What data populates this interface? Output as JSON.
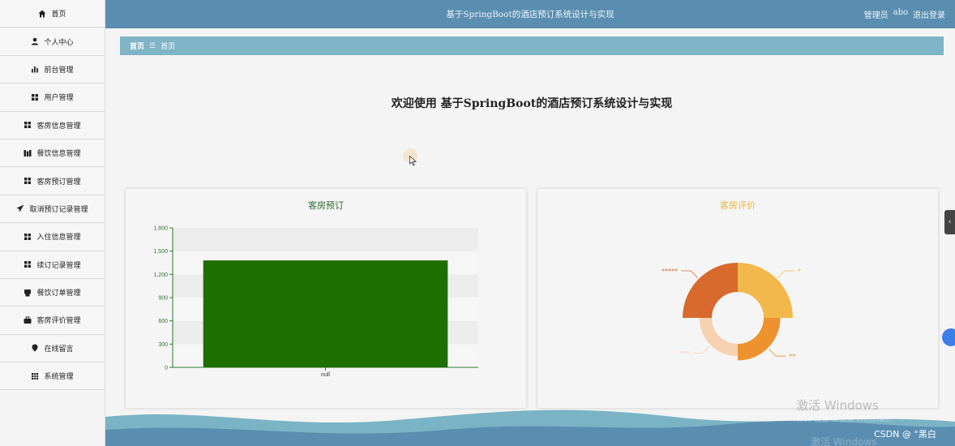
{
  "header": {
    "title": "基于SpringBoot的酒店预订系统设计与实现",
    "role": "管理员",
    "username": "abo",
    "logout_label": "退出登录"
  },
  "sidebar": {
    "items": [
      {
        "label": "首页",
        "icon": "home-icon"
      },
      {
        "label": "个人中心",
        "icon": "user-icon"
      },
      {
        "label": "前台管理",
        "icon": "bar-chart-icon"
      },
      {
        "label": "用户管理",
        "icon": "grid-icon"
      },
      {
        "label": "客房信息管理",
        "icon": "grid-icon"
      },
      {
        "label": "餐饮信息管理",
        "icon": "columns-icon"
      },
      {
        "label": "客房预订管理",
        "icon": "grid-icon"
      },
      {
        "label": "取消预订记录管理",
        "icon": "send-icon"
      },
      {
        "label": "入住信息管理",
        "icon": "grid-icon"
      },
      {
        "label": "续订记录管理",
        "icon": "grid-icon"
      },
      {
        "label": "餐饮订单管理",
        "icon": "print-icon"
      },
      {
        "label": "客房评价管理",
        "icon": "briefcase-icon"
      },
      {
        "label": "在线留言",
        "icon": "pin-icon"
      },
      {
        "label": "系统管理",
        "icon": "table-icon"
      }
    ]
  },
  "breadcrumb": {
    "home": "首页",
    "separator": "☰",
    "current": "首页"
  },
  "welcome": {
    "prefix": "欢迎使用",
    "system_name": "基于SpringBoot的酒店预订系统设计与实现"
  },
  "watermark": {
    "line1": "激活 Windows",
    "line2": "转到\"设置\"以激活 Windows。",
    "line3": "激活 Windows",
    "csdn": "CSDN @ °黑白"
  },
  "chart_data": [
    {
      "type": "bar",
      "title": "客房预订",
      "categories": [
        "null"
      ],
      "values": [
        1380
      ],
      "ylim": [
        0,
        1800
      ],
      "yticks": [
        0,
        300,
        600,
        900,
        1200,
        1500,
        1800
      ],
      "ytick_labels": [
        "0",
        "300",
        "600",
        "900",
        "1,200",
        "1,500",
        "1,800"
      ],
      "bar_color": "#1e6e00",
      "axis_color": "#2d7a2d",
      "band_colors": [
        "#ececec",
        "#f6f6f6"
      ]
    },
    {
      "type": "pie",
      "subtype": "rose-donut",
      "title": "客房评价",
      "labels": [
        "*",
        "**",
        "***",
        "*****"
      ],
      "values": [
        3.5,
        2,
        1.5,
        3.5
      ],
      "colors": [
        "#f2b84b",
        "#ee922f",
        "#f6d2b0",
        "#d76a2c"
      ]
    }
  ]
}
